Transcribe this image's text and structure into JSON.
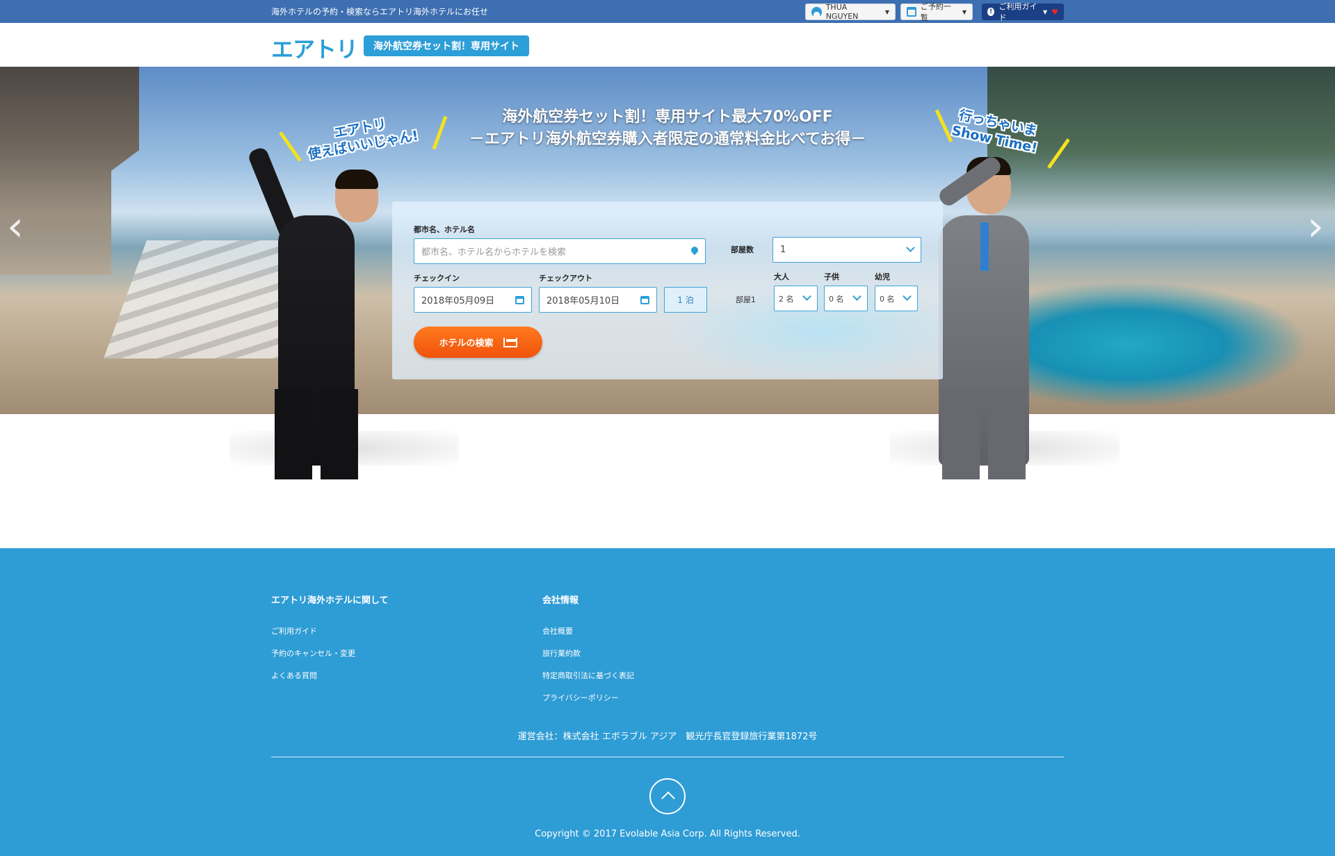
{
  "topbar": {
    "tagline": "海外ホテルの予約・検索ならエアトリ海外ホテルにお任せ",
    "user_name": "THUA NGUYEN",
    "reservations": "ご予約一覧",
    "guide": "ご利用ガイド"
  },
  "header": {
    "logo": "エアトリ",
    "site_badge": "海外航空券セット割！専用サイト"
  },
  "hero": {
    "title_line1": "海外航空券セット割！専用サイト最大70%OFF",
    "title_line2": "－エアトリ海外航空券購入者限定の通常料金比べてお得－",
    "callout_left_1": "エアトリ",
    "callout_left_2": "使えばいいじゃん!",
    "callout_right_1": "行っちゃいま",
    "callout_right_2": "Show Time!"
  },
  "search": {
    "destination_label": "都市名、ホテル名",
    "destination_placeholder": "都市名、ホテル名からホテルを検索",
    "rooms_label": "部屋数",
    "rooms_value": "1",
    "checkin_label": "チェックイン",
    "checkin_value": "2018年05月09日",
    "checkout_label": "チェックアウト",
    "checkout_value": "2018年05月10日",
    "nights": "1 泊",
    "room1_label": "部屋1",
    "adults_label": "大人",
    "adults_value": "2 名",
    "children_label": "子供",
    "children_value": "0 名",
    "infants_label": "幼児",
    "infants_value": "0 名",
    "search_button": "ホテルの検索"
  },
  "footer": {
    "col1_heading": "エアトリ海外ホテルに関して",
    "col1_links": [
      "ご利用ガイド",
      "予約のキャンセル・変更",
      "よくある質問"
    ],
    "col2_heading": "会社情報",
    "col2_links": [
      "会社概要",
      "旅行業約款",
      "特定商取引法に基づく表記",
      "プライバシーポリシー"
    ],
    "company_line": "運営会社：株式会社 エボラブル アジア　観光庁長官登録旅行業第1872号",
    "copyright": "Copyright © 2017 Evolable Asia Corp. All Rights Reserved."
  },
  "colors": {
    "topbar": "#3d6fb2",
    "brand_blue": "#2c9ed8",
    "guide_navy": "#1b3f84",
    "search_orange": "#f0520b",
    "footer_blue": "#2e9cd5"
  }
}
